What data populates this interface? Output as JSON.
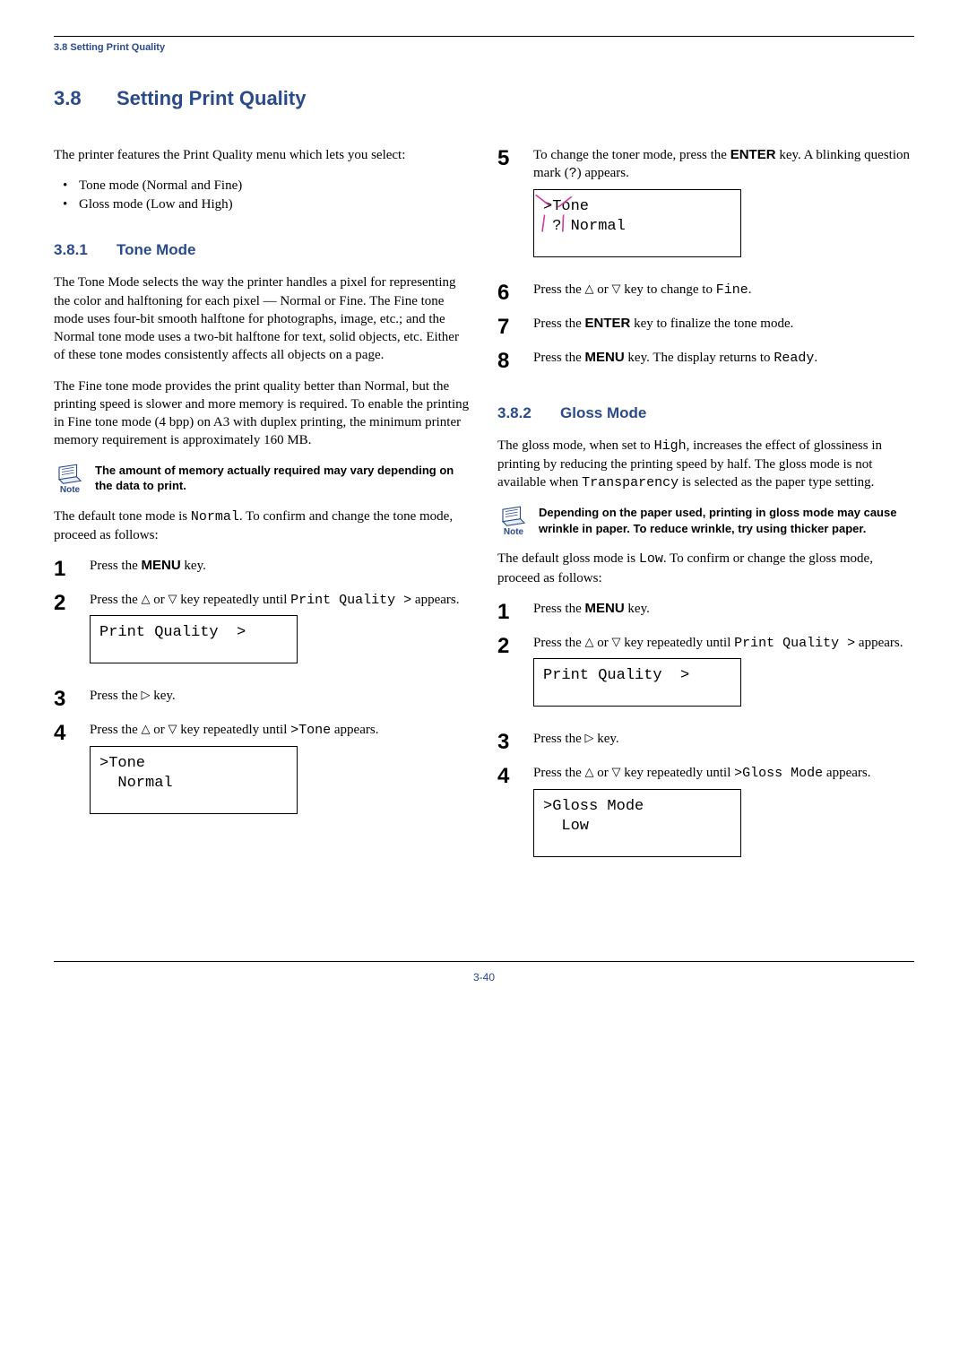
{
  "header": {
    "breadcrumb": "3.8 Setting Print Quality"
  },
  "title": {
    "num": "3.8",
    "text": "Setting Print Quality"
  },
  "intro": "The printer features the Print Quality menu which lets you select:",
  "bullets": [
    "Tone mode (Normal and Fine)",
    "Gloss mode (Low and High)"
  ],
  "sub1": {
    "num": "3.8.1",
    "title": "Tone Mode",
    "p1": "The Tone Mode selects the way the printer handles a pixel for representing the color and halftoning for each pixel — Normal or Fine. The Fine tone mode uses four-bit smooth halftone for photographs, image, etc.; and the Normal tone mode uses a two-bit halftone for text, solid objects, etc. Either of these tone modes consistently affects all objects on a page.",
    "p2": "The Fine tone mode provides the print quality better than Normal, but the printing speed is slower and more memory is required. To enable the printing in Fine tone mode (4 bpp) on A3 with duplex printing, the minimum printer memory requirement is approximately 160 MB.",
    "note_label": "Note",
    "note_text": "The amount of memory actually required may vary depending on the data to print.",
    "p3_a": "The default tone mode is ",
    "p3_mono": "Normal",
    "p3_b": ". To confirm and change the tone mode, proceed as follows:",
    "steps": {
      "s1": {
        "a": "Press the ",
        "key": "MENU",
        "b": " key."
      },
      "s2": {
        "a": "Press the ",
        "b": " or ",
        "c": " key repeatedly until ",
        "mono": "Print Quality >",
        "d": " appears.",
        "display": "Print Quality  >"
      },
      "s3": {
        "a": "Press the ",
        "b": " key."
      },
      "s4": {
        "a": "Press the ",
        "b": " or ",
        "c": " key repeatedly until ",
        "mono": ">Tone",
        "d": " appears.",
        "display": ">Tone\n  Normal"
      },
      "s5": {
        "a": "To change the toner mode, press the ",
        "key": "ENTER",
        "b": " key. A blinking question mark (",
        "mono": "?",
        "c": ") appears.",
        "display": ">Tone\n ? Normal"
      },
      "s6": {
        "a": "Press the ",
        "b": " or ",
        "c": " key to change to ",
        "mono": "Fine",
        "d": "."
      },
      "s7": {
        "a": "Press the ",
        "key": "ENTER",
        "b": " key to finalize the tone mode."
      },
      "s8": {
        "a": "Press the ",
        "key": "MENU",
        "b": " key. The display returns to ",
        "mono": "Ready",
        "c": "."
      }
    }
  },
  "sub2": {
    "num": "3.8.2",
    "title": "Gloss Mode",
    "p1_a": "The gloss mode, when set to ",
    "p1_mono1": "High",
    "p1_b": ", increases the effect of glossiness in printing by reducing the printing speed by half. The gloss mode is not available when ",
    "p1_mono2": "Transparency",
    "p1_c": " is selected as the paper type setting.",
    "note_label": "Note",
    "note_text": "Depending on the paper used, printing in gloss mode may cause wrinkle in paper. To reduce wrinkle, try using thicker paper.",
    "p2_a": "The default gloss mode is ",
    "p2_mono": "Low",
    "p2_b": ". To confirm or change the gloss mode, proceed as follows:",
    "steps": {
      "s1": {
        "a": "Press the ",
        "key": "MENU",
        "b": " key."
      },
      "s2": {
        "a": "Press the ",
        "b": " or ",
        "c": " key repeatedly until ",
        "mono": "Print Quality >",
        "d": " appears.",
        "display": "Print Quality  >"
      },
      "s3": {
        "a": "Press the ",
        "b": " key."
      },
      "s4": {
        "a": "Press the ",
        "b": " or ",
        "c": " key repeatedly until ",
        "mono": ">Gloss Mode",
        "d": " appears.",
        "display": ">Gloss Mode\n  Low"
      }
    }
  },
  "page_number": "3-40"
}
